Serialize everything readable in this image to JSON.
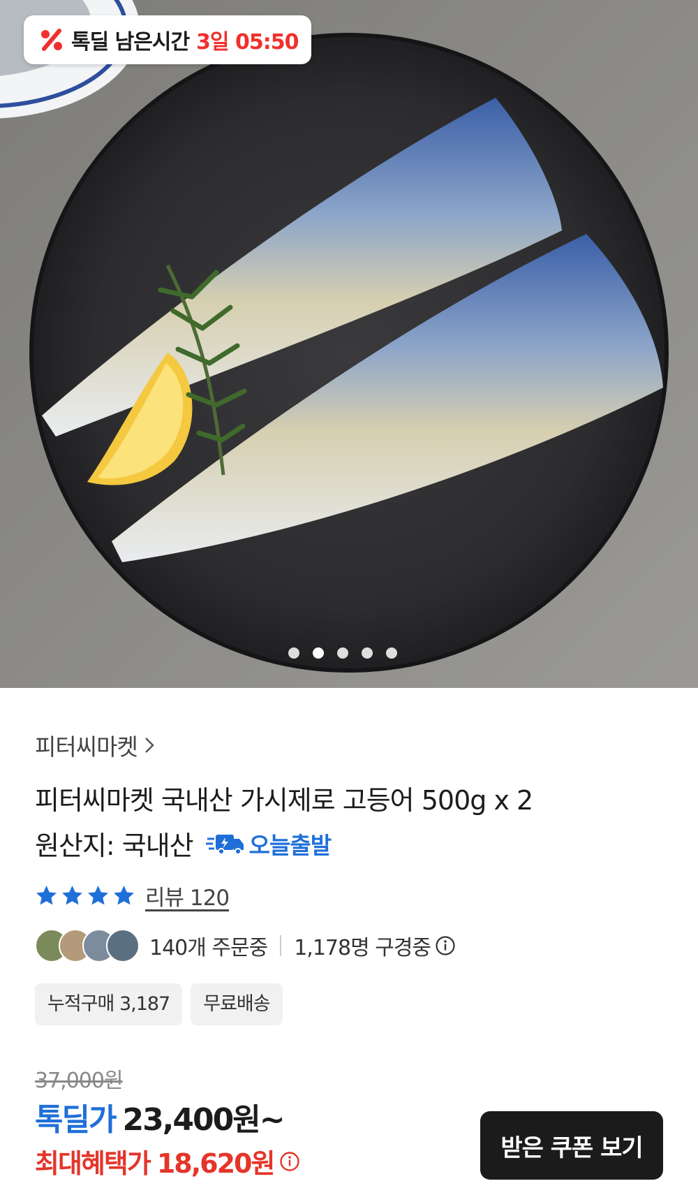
{
  "deal_timer": {
    "label": "톡딜 남은시간",
    "remaining": "3일 05:50"
  },
  "carousel": {
    "total": 5,
    "active": 1
  },
  "seller": {
    "name": "피터씨마켓"
  },
  "product": {
    "title": "피터씨마켓 국내산 가시제로 고등어 500g x 2",
    "origin": "원산지: 국내산",
    "delivery_badge": "오늘출발"
  },
  "rating": {
    "stars": 4,
    "review_label": "리뷰 120"
  },
  "social": {
    "ordering": "140개 주문중",
    "viewing": "1,178명 구경중"
  },
  "chips": [
    "누적구매 3,187",
    "무료배송"
  ],
  "price": {
    "original": "37,000원",
    "deal_tag": "톡딜가",
    "deal_amount": "23,400원~",
    "max_tag": "최대혜택가",
    "max_amount": "18,620원"
  },
  "coupon_button": "받은 쿠폰 보기",
  "colors": {
    "accent_blue": "#1f6fd8",
    "accent_red": "#e4352a",
    "timer_red": "#f0302c",
    "button_dark": "#1b1b1b"
  }
}
